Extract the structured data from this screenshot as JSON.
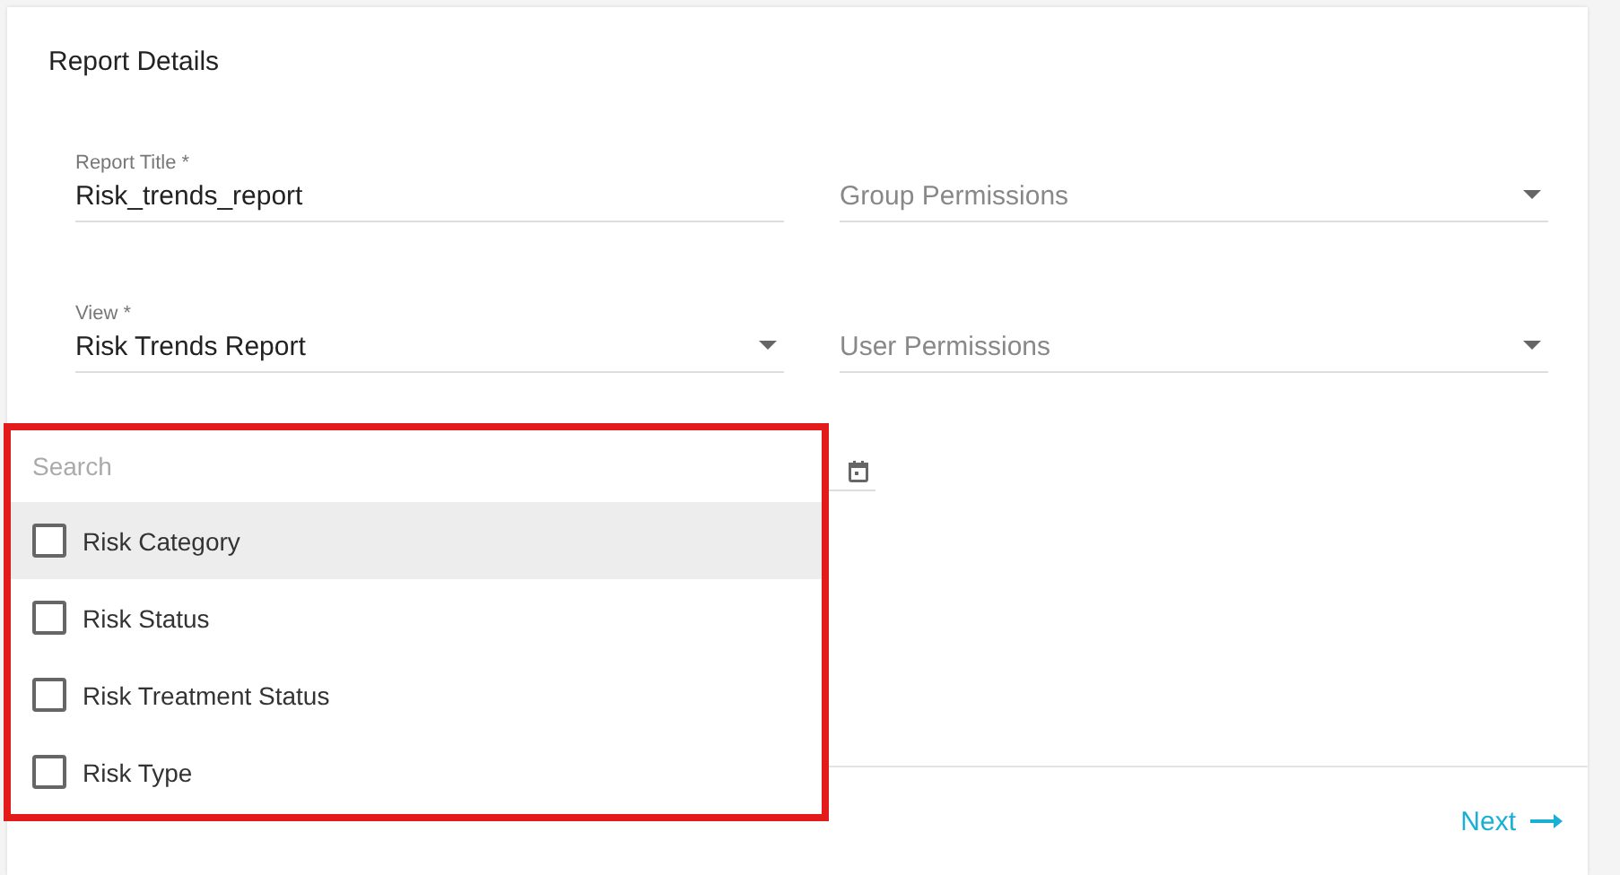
{
  "section_title": "Report Details",
  "fields": [
    {
      "kind": "text",
      "label": "Report Title *",
      "value": "Risk_trends_report"
    },
    {
      "kind": "select",
      "placeholder": "Group Permissions"
    },
    {
      "kind": "select",
      "label": "View *",
      "value": "Risk Trends Report"
    },
    {
      "kind": "select",
      "placeholder": "User Permissions"
    },
    {
      "kind": "date"
    }
  ],
  "dropdown": {
    "search_placeholder": "Search",
    "options": [
      {
        "label": "Risk Category",
        "checked": false,
        "highlighted": true
      },
      {
        "label": "Risk Status",
        "checked": false,
        "highlighted": false
      },
      {
        "label": "Risk Treatment Status",
        "checked": false,
        "highlighted": false
      },
      {
        "label": "Risk Type",
        "checked": false,
        "highlighted": false
      }
    ]
  },
  "next_button": "Next"
}
